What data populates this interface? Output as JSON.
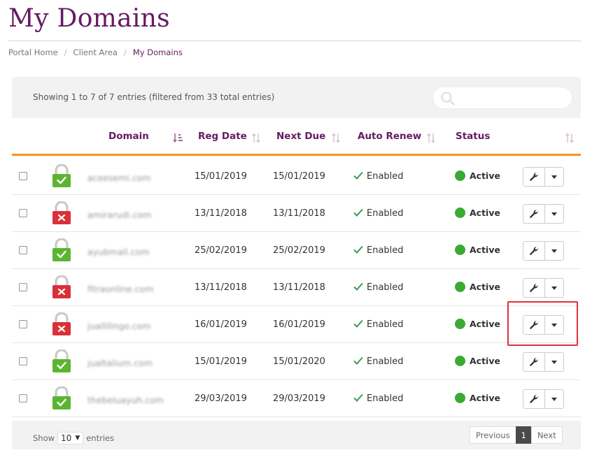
{
  "page": {
    "title": "My Domains"
  },
  "breadcrumb": {
    "items": [
      "Portal Home",
      "Client Area",
      "My Domains"
    ]
  },
  "table": {
    "info": "Showing 1 to 7 of 7 entries (filtered from 33 total entries)",
    "search": {
      "value": "",
      "placeholder": ""
    },
    "columns": [
      "Domain",
      "Reg Date",
      "Next Due",
      "Auto Renew",
      "Status"
    ],
    "rows": [
      {
        "domain": "aceesemi.com",
        "ssl": "green",
        "reg_date": "15/01/2019",
        "next_due": "15/01/2019",
        "auto_renew": "Enabled",
        "status": "Active"
      },
      {
        "domain": "amirarudi.com",
        "ssl": "red",
        "reg_date": "13/11/2018",
        "next_due": "13/11/2018",
        "auto_renew": "Enabled",
        "status": "Active"
      },
      {
        "domain": "ayubmall.com",
        "ssl": "green",
        "reg_date": "25/02/2019",
        "next_due": "25/02/2019",
        "auto_renew": "Enabled",
        "status": "Active"
      },
      {
        "domain": "fitraonline.com",
        "ssl": "red",
        "reg_date": "13/11/2018",
        "next_due": "13/11/2018",
        "auto_renew": "Enabled",
        "status": "Active"
      },
      {
        "domain": "juallilingo.com",
        "ssl": "red",
        "reg_date": "16/01/2019",
        "next_due": "16/01/2019",
        "auto_renew": "Enabled",
        "status": "Active"
      },
      {
        "domain": "jualtalium.com",
        "ssl": "green",
        "reg_date": "15/01/2019",
        "next_due": "15/01/2020",
        "auto_renew": "Enabled",
        "status": "Active"
      },
      {
        "domain": "thebeluayuh.com",
        "ssl": "green",
        "reg_date": "29/03/2019",
        "next_due": "29/03/2019",
        "auto_renew": "Enabled",
        "status": "Active"
      }
    ]
  },
  "footer": {
    "show_label": "Show",
    "page_length": "10",
    "entries_label": "entries",
    "previous_label": "Previous",
    "current_page": "1",
    "next_label": "Next"
  },
  "colors": {
    "brand": "#651b63",
    "accent": "#f39321",
    "active_status": "#3aaa35",
    "ssl_ok": "#5cb531",
    "ssl_fail": "#d9303a",
    "highlight": "#e0303a"
  },
  "icons": [
    "search-icon",
    "lock-icon",
    "check-icon",
    "wrench-icon",
    "chevron-down-icon",
    "sort-icon"
  ]
}
